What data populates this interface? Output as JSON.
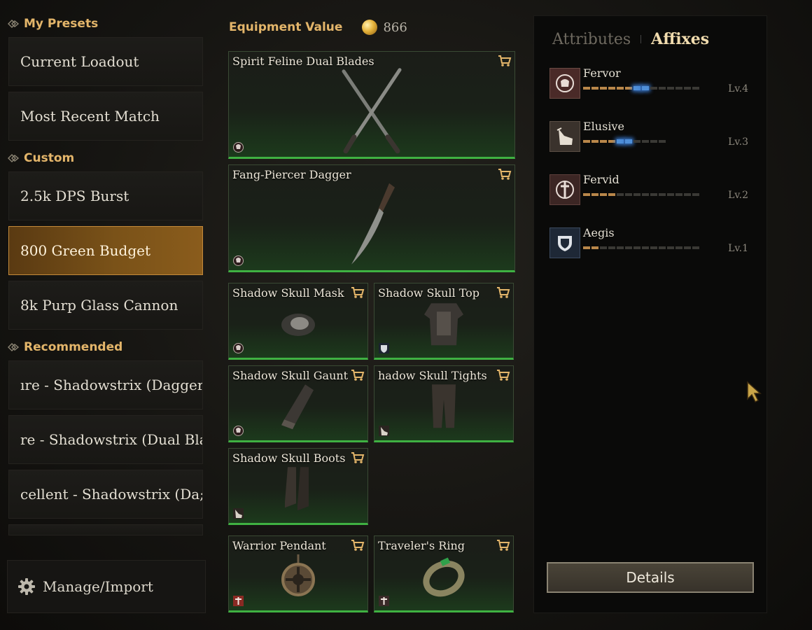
{
  "presets": {
    "my_presets_label": "My Presets",
    "my_presets": [
      "Current Loadout",
      "Most Recent Match"
    ],
    "custom_label": "Custom",
    "custom": [
      "2.5k DPS Burst",
      "800 Green Budget",
      "8k Purp Glass Cannon"
    ],
    "selected": "800 Green Budget",
    "recommended_label": "Recommended",
    "recommended": [
      "ıre - Shadowstrix (Dagger",
      "re - Shadowstrix (Dual Bla",
      "cellent - Shadowstrix (Da;"
    ],
    "manage_label": "Manage/Import"
  },
  "equipment": {
    "value_label": "Equipment Value",
    "value": "866",
    "items": [
      {
        "name": "Spirit Feline Dual Blades",
        "slot": "weapon-1",
        "badge": "fervor-icon"
      },
      {
        "name": "Fang-Piercer Dagger",
        "slot": "weapon-2",
        "badge": "fervor-icon"
      },
      {
        "name": "Shadow Skull Mask",
        "slot": "head",
        "badge": "fervor-icon"
      },
      {
        "name": "Shadow Skull Top",
        "slot": "chest",
        "badge": "aegis-icon"
      },
      {
        "name": "Shadow Skull Gaunt",
        "slot": "hands",
        "badge": "fervor-icon"
      },
      {
        "name": "hadow Skull Tights",
        "slot": "legs",
        "badge": "elusive-icon"
      },
      {
        "name": "Shadow Skull Boots",
        "slot": "feet",
        "badge": "elusive-icon"
      },
      {
        "name": "Warrior Pendant",
        "slot": "neck",
        "badge": "fervid-icon"
      },
      {
        "name": "Traveler's Ring",
        "slot": "ring",
        "badge": "fervid-icon"
      }
    ]
  },
  "panel": {
    "tabs": [
      "Attributes",
      "Affixes"
    ],
    "active_tab": "Affixes",
    "affixes": [
      {
        "name": "Fervor",
        "level": "Lv.4",
        "filled": 6,
        "current": 2,
        "total": 14,
        "icon": "fist-icon"
      },
      {
        "name": "Elusive",
        "level": "Lv.3",
        "filled": 4,
        "current": 2,
        "total": 10,
        "icon": "boot-icon"
      },
      {
        "name": "Fervid",
        "level": "Lv.2",
        "filled": 4,
        "current": 0,
        "total": 14,
        "icon": "sword-icon"
      },
      {
        "name": "Aegis",
        "level": "Lv.1",
        "filled": 2,
        "current": 0,
        "total": 14,
        "icon": "shield-icon"
      }
    ],
    "details_label": "Details"
  },
  "colors": {
    "accent": "#e3b56a",
    "rarity_green": "#3fb142",
    "selected_preset": "#7a5218",
    "affix_bar": "#b9874a",
    "affix_current": "#4f8fd8"
  }
}
